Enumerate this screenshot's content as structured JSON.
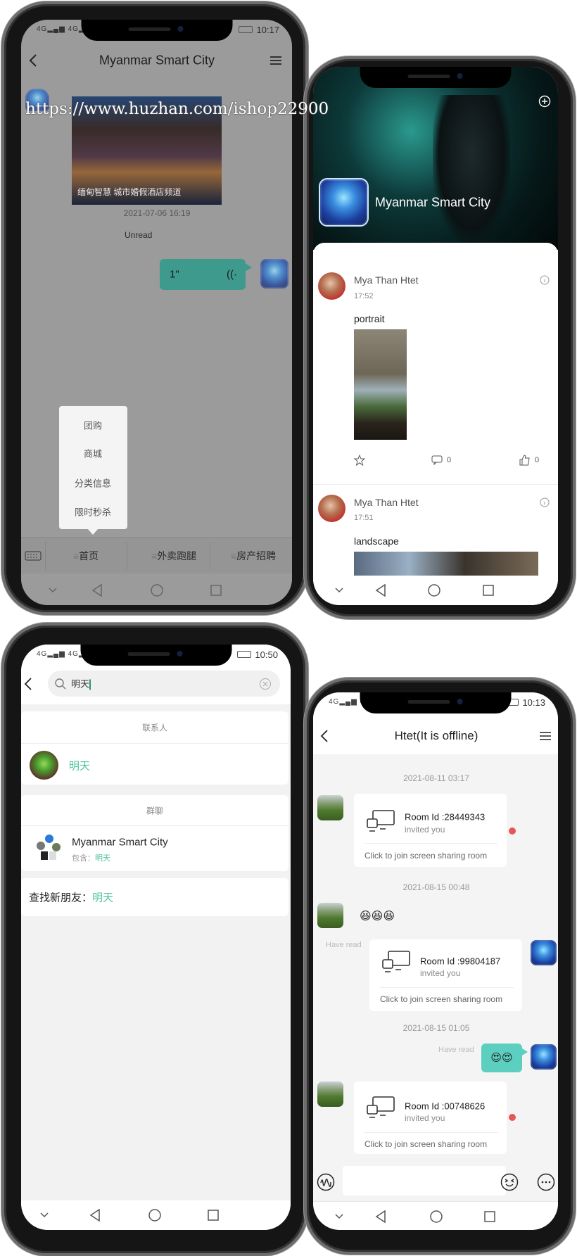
{
  "watermark": "https://www.huzhan.com/ishop22900",
  "colors": {
    "accent_green": "#4ec49c",
    "bubble_teal": "#5ccfc0",
    "unread_dot": "#e85555"
  },
  "phone1": {
    "status_time": "10:17",
    "title": "Myanmar Smart City",
    "banner_caption": "缅甸智慧 城市婚假酒店频道",
    "timestamp": "2021-07-06 16:19",
    "unread_label": "Unread",
    "voice_duration": "1\"",
    "popup_items": [
      "团购",
      "商城",
      "分类信息",
      "限时秒杀"
    ],
    "tabs": [
      "首页",
      "外卖跑腿",
      "房产招聘"
    ]
  },
  "phone2": {
    "group_name": "Myanmar Smart City",
    "posts": [
      {
        "author": "Mya Than Htet",
        "time": "17:52",
        "text": "portrait",
        "comments": "0",
        "likes": "0"
      },
      {
        "author": "Mya Than Htet",
        "time": "17:51",
        "text": "landscape"
      }
    ]
  },
  "phone3": {
    "status_time": "10:50",
    "search_value": "明天",
    "contacts_header": "联系人",
    "contact_name": "明天",
    "groups_header": "群聊",
    "group_name": "Myanmar Smart City",
    "group_contains_label": "包含：",
    "group_contains_match": "明天",
    "find_label": "查找新朋友：",
    "find_match": "明天"
  },
  "phone4": {
    "status_time": "10:13",
    "title": "Htet(It is offline)",
    "timestamps": [
      "2021-08-11 03:17",
      "2021-08-15 00:48",
      "2021-08-15 01:05"
    ],
    "rooms": [
      {
        "title": "Room Id :28449343",
        "sub": "invited you",
        "link": "Click to join screen sharing room"
      },
      {
        "title": "Room Id :99804187",
        "sub": "invited you",
        "link": "Click to join screen sharing room"
      },
      {
        "title": "Room Id :00748626",
        "sub": "invited you",
        "link": "Click to join screen sharing room"
      }
    ],
    "emoji_message": "😆😆😆",
    "emoji_reply": "😍😍",
    "read_label": "Have read"
  }
}
